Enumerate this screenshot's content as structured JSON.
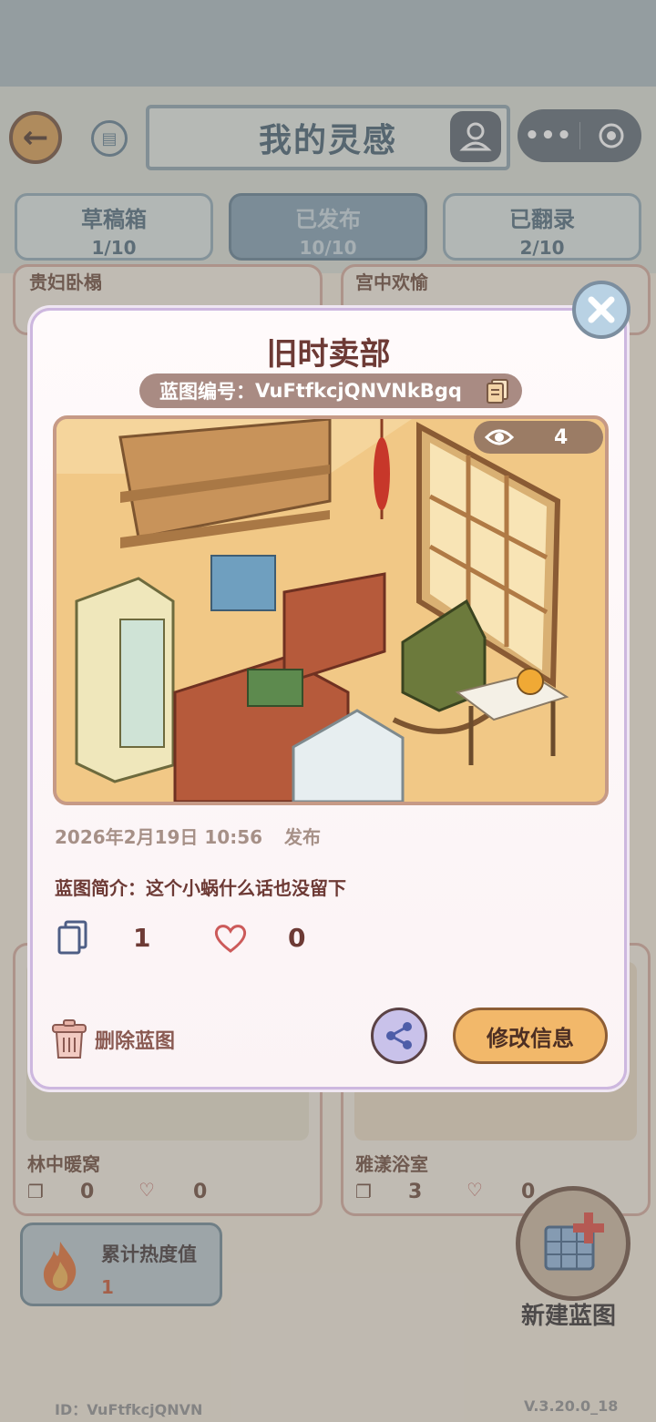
{
  "header": {
    "title": "我的灵感",
    "back_icon": "←",
    "more_icon": "•••"
  },
  "tabs": [
    {
      "label": "草稿箱",
      "count": "1/10"
    },
    {
      "label": "已发布",
      "count": "10/10"
    },
    {
      "label": "已翻录",
      "count": "2/10"
    }
  ],
  "background_cards": [
    {
      "name": "贵妇卧榻"
    },
    {
      "name": "宫中欢愉"
    },
    {
      "name": "林中暖窝",
      "copies": "0",
      "likes": "0"
    },
    {
      "name": "雅漾浴室",
      "copies": "3",
      "likes": "0"
    }
  ],
  "modal": {
    "title": "旧时卖部",
    "code_label": "蓝图编号：",
    "code_value": "VuFtfkcjQNVNkBgq",
    "views": "4",
    "date": "2026年2月19日 10:56",
    "status": "发布",
    "description": "蓝图简介：这个小蜗什么话也没留下",
    "copies": "1",
    "likes": "0",
    "delete_label": "删除蓝图",
    "edit_label": "修改信息"
  },
  "heat": {
    "label": "累计热度值",
    "value": "1"
  },
  "new_blueprint_label": "新建蓝图",
  "footer": {
    "id": "ID：VuFtfkcjQNVN",
    "version": "V.3.20.0_18"
  },
  "colors": {
    "modal_title": "#6d3a35",
    "edit_button": "#f2b86a",
    "active_tab": "#7e9bae"
  }
}
